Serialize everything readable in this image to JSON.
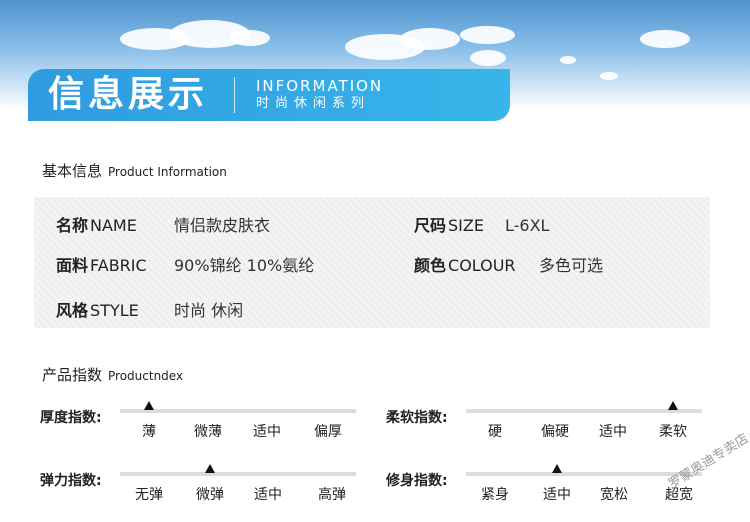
{
  "banner": {
    "title": "信息展示",
    "en": "INFORMATION",
    "cn": "时尚休闲系列"
  },
  "basic_info": {
    "title": "基本信息",
    "title_en": "Product Information",
    "fields": {
      "name": {
        "label": "名称",
        "label_en": "NAME",
        "value": "情侣款皮肤衣"
      },
      "size": {
        "label": "尺码",
        "label_en": "SIZE",
        "value": "L-6XL"
      },
      "fabric": {
        "label": "面料",
        "label_en": "FABRIC",
        "value": "90%锦纶 10%氨纶"
      },
      "color": {
        "label": "颜色",
        "label_en": "COLOUR",
        "value": "多色可选"
      },
      "style": {
        "label": "风格",
        "label_en": "STYLE",
        "value": "时尚 休闲"
      }
    }
  },
  "product_index": {
    "title": "产品指数",
    "title_en": "Productndex",
    "indices": [
      {
        "label": "厚度指数:",
        "options": [
          "薄",
          "微薄",
          "适中",
          "偏厚"
        ],
        "selected_index": 0
      },
      {
        "label": "柔软指数:",
        "options": [
          "硬",
          "偏硬",
          "适中",
          "柔软"
        ],
        "selected_index": 3
      },
      {
        "label": "弹力指数:",
        "options": [
          "无弹",
          "微弹",
          "适中",
          "高弹"
        ],
        "selected_index": 1
      },
      {
        "label": "修身指数:",
        "options": [
          "紧身",
          "适中",
          "宽松",
          "超宽"
        ],
        "selected_index": 1
      }
    ]
  },
  "watermark": "罗蒙奥迪专卖店"
}
